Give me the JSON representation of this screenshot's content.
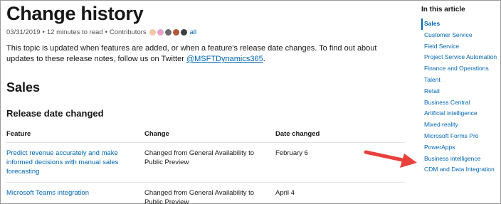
{
  "article": {
    "title": "Change history",
    "date": "03/31/2019",
    "bullet": "•",
    "read_time": "12 minutes to read",
    "contributors_label": "Contributors",
    "all_label": "all",
    "avatars": [
      {
        "color": "#f2c7a3"
      },
      {
        "color": "#e8a0c8"
      },
      {
        "color": "#6b6b6b"
      },
      {
        "color": "#b5563c"
      },
      {
        "color": "#3d3d3d"
      }
    ],
    "intro_text": "This topic is updated when features are added, or when a feature's release date changes. To find out about updates to these release notes, follow us on Twitter ",
    "intro_link": "@MSFTDynamics365",
    "intro_end": ".",
    "section_title": "Sales",
    "subsection_title": "Release date changed"
  },
  "table": {
    "headers": [
      "Feature",
      "Change",
      "Date changed"
    ],
    "rows": [
      {
        "feature": "Predict revenue accurately and make informed decisions with manual sales forecasting",
        "change": "Changed from General Availability to Public Preview",
        "date": "February 6"
      },
      {
        "feature": "Microsoft Teams integration",
        "change": "Changed from General Availability to Public Preview",
        "date": "April 4"
      }
    ]
  },
  "toc": {
    "heading": "In this article",
    "items": [
      "Sales",
      "Customer Service",
      "Field Service",
      "Project Service Automation",
      "Finance and Operations",
      "Talent",
      "Retail",
      "Business Central",
      "Artificial intelligence",
      "Mixed reality",
      "Microsoft Forms Pro",
      "PowerApps",
      "Business intelligence",
      "CDM and Data Integration"
    ],
    "active_index": 0
  },
  "annotation": {
    "arrow_color": "#e8413c"
  }
}
